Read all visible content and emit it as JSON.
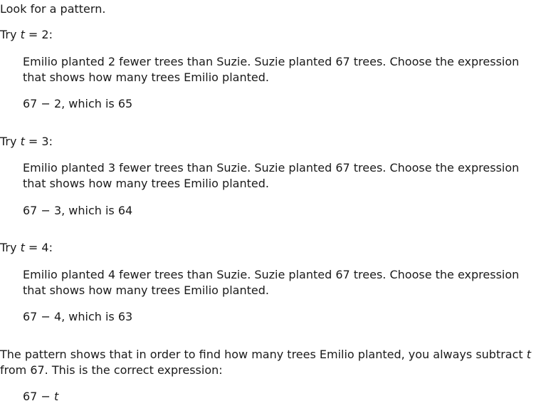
{
  "intro": "Look for a pattern.",
  "trials": [
    {
      "label_prefix": "Try ",
      "var": "t",
      "label_suffix": " = 2:",
      "problem": "Emilio planted 2 fewer trees than Suzie. Suzie planted 67 trees. Choose the expression that shows how many trees Emilio planted.",
      "answer": "67 − 2, which is 65"
    },
    {
      "label_prefix": "Try ",
      "var": "t",
      "label_suffix": " = 3:",
      "problem": "Emilio planted 3 fewer trees than Suzie. Suzie planted 67 trees. Choose the expression that shows how many trees Emilio planted.",
      "answer": "67 − 3, which is 64"
    },
    {
      "label_prefix": "Try ",
      "var": "t",
      "label_suffix": " = 4:",
      "problem": "Emilio planted 4 fewer trees than Suzie. Suzie planted 67 trees. Choose the expression that shows how many trees Emilio planted.",
      "answer": "67 − 4, which is 63"
    }
  ],
  "conclusion": {
    "text_before": "The pattern shows that in order to find how many trees Emilio planted, you always subtract ",
    "var": "t",
    "text_after": " from 67. This is the correct expression:",
    "expression_prefix": "67 − ",
    "expression_var": "t"
  }
}
